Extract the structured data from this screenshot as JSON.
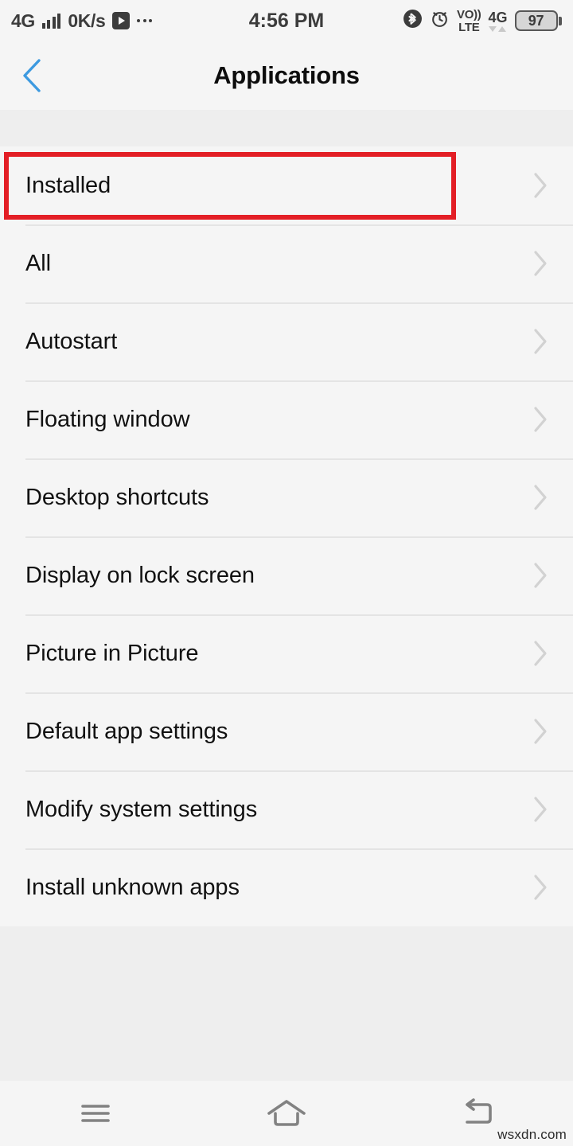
{
  "status_bar": {
    "network_type": "4G",
    "signal_icon": "signal-bars-icon",
    "data_rate": "0K/s",
    "notification_icons": [
      "video-play-icon",
      "more-notifications-icon"
    ],
    "time": "4:56 PM",
    "bluetooth_icon": "bluetooth-icon",
    "alarm_icon": "alarm-clock-icon",
    "volte_line1": "VO))",
    "volte_line2": "LTE",
    "data_network": "4G",
    "battery_level": "97"
  },
  "app_bar": {
    "back_icon": "back-chevron-icon",
    "title": "Applications",
    "back_color": "#3d9ae0"
  },
  "list": {
    "items": [
      {
        "label": "Installed",
        "chevron": "chevron-right-icon",
        "highlighted": true
      },
      {
        "label": "All",
        "chevron": "chevron-right-icon",
        "highlighted": false
      },
      {
        "label": "Autostart",
        "chevron": "chevron-right-icon",
        "highlighted": false
      },
      {
        "label": "Floating window",
        "chevron": "chevron-right-icon",
        "highlighted": false
      },
      {
        "label": "Desktop shortcuts",
        "chevron": "chevron-right-icon",
        "highlighted": false
      },
      {
        "label": "Display on lock screen",
        "chevron": "chevron-right-icon",
        "highlighted": false
      },
      {
        "label": "Picture in Picture",
        "chevron": "chevron-right-icon",
        "highlighted": false
      },
      {
        "label": "Default app settings",
        "chevron": "chevron-right-icon",
        "highlighted": false
      },
      {
        "label": "Modify system settings",
        "chevron": "chevron-right-icon",
        "highlighted": false
      },
      {
        "label": "Install unknown apps",
        "chevron": "chevron-right-icon",
        "highlighted": false
      }
    ]
  },
  "highlight": {
    "color": "#e31f26",
    "target": "Installed"
  },
  "nav_bar": {
    "buttons": [
      {
        "icon": "menu-icon",
        "name": "recents-menu-button"
      },
      {
        "icon": "home-icon",
        "name": "home-button"
      },
      {
        "icon": "back-arrow-icon",
        "name": "back-button"
      }
    ]
  },
  "watermark": {
    "text": "wsxdn.com"
  }
}
